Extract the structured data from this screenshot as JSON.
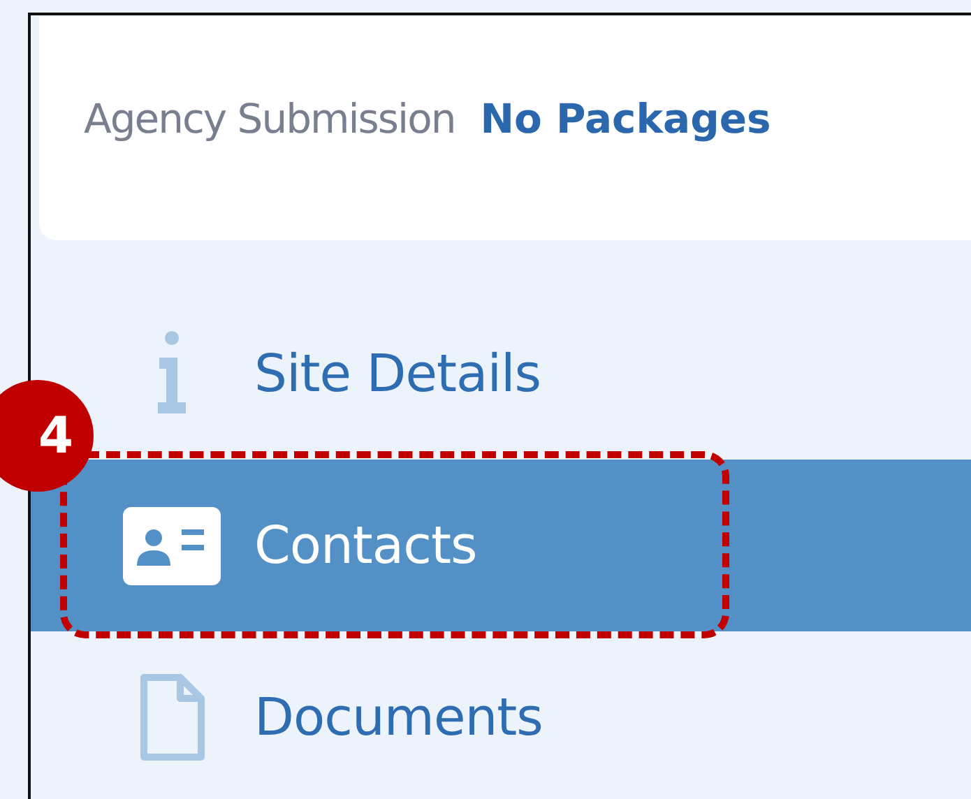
{
  "header": {
    "label": "Agency Submission",
    "value": "No Packages"
  },
  "nav_items": [
    {
      "kind": "info",
      "label": "Site Details",
      "selected": false
    },
    {
      "kind": "contact",
      "label": "Contacts",
      "selected": true
    },
    {
      "kind": "document",
      "label": "Documents",
      "selected": false
    }
  ],
  "callout": {
    "number": "4"
  }
}
